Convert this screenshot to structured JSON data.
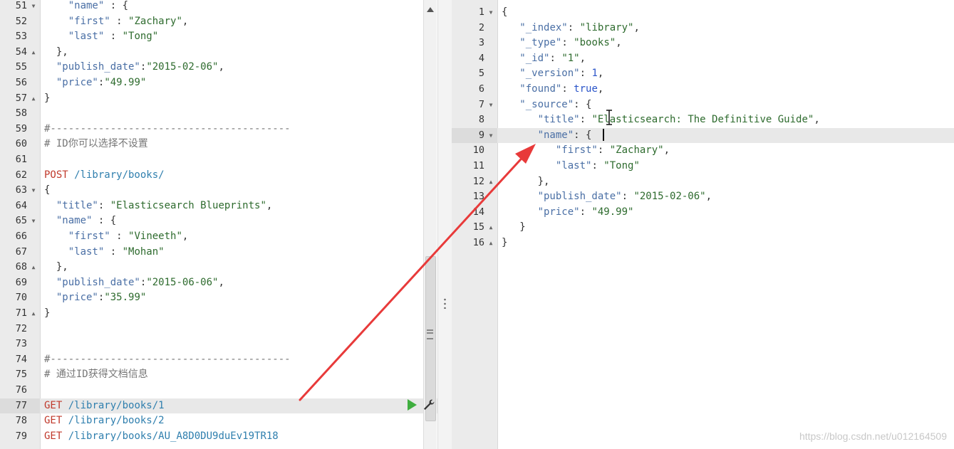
{
  "left_editor": {
    "lines": [
      {
        "n": "51",
        "fold": "down",
        "tokens": [
          [
            "    ",
            ""
          ],
          [
            "\"name\"",
            "key"
          ],
          [
            " : {",
            "punct"
          ]
        ]
      },
      {
        "n": "52",
        "fold": "",
        "tokens": [
          [
            "    ",
            ""
          ],
          [
            "\"first\"",
            "key"
          ],
          [
            " : ",
            "punct"
          ],
          [
            "\"Zachary\"",
            "str"
          ],
          [
            ",",
            "punct"
          ]
        ]
      },
      {
        "n": "53",
        "fold": "",
        "tokens": [
          [
            "    ",
            ""
          ],
          [
            "\"last\"",
            "key"
          ],
          [
            " : ",
            "punct"
          ],
          [
            "\"Tong\"",
            "str"
          ]
        ]
      },
      {
        "n": "54",
        "fold": "up",
        "tokens": [
          [
            "  },",
            "punct"
          ]
        ]
      },
      {
        "n": "55",
        "fold": "",
        "tokens": [
          [
            "  ",
            ""
          ],
          [
            "\"publish_date\"",
            "key"
          ],
          [
            ":",
            "punct"
          ],
          [
            "\"2015-02-06\"",
            "str"
          ],
          [
            ",",
            "punct"
          ]
        ]
      },
      {
        "n": "56",
        "fold": "",
        "tokens": [
          [
            "  ",
            ""
          ],
          [
            "\"price\"",
            "key"
          ],
          [
            ":",
            "punct"
          ],
          [
            "\"49.99\"",
            "str"
          ]
        ]
      },
      {
        "n": "57",
        "fold": "up",
        "tokens": [
          [
            "}",
            "punct"
          ]
        ]
      },
      {
        "n": "58",
        "fold": "",
        "tokens": []
      },
      {
        "n": "59",
        "fold": "",
        "tokens": [
          [
            "#----------------------------------------",
            "cmt"
          ]
        ]
      },
      {
        "n": "60",
        "fold": "",
        "tokens": [
          [
            "# ID你可以选择不设置",
            "cmt"
          ]
        ]
      },
      {
        "n": "61",
        "fold": "",
        "tokens": []
      },
      {
        "n": "62",
        "fold": "",
        "tokens": [
          [
            "POST",
            "method"
          ],
          [
            " /library/books/",
            "url"
          ]
        ]
      },
      {
        "n": "63",
        "fold": "down",
        "tokens": [
          [
            "{",
            "punct"
          ]
        ]
      },
      {
        "n": "64",
        "fold": "",
        "tokens": [
          [
            "  ",
            ""
          ],
          [
            "\"title\"",
            "key"
          ],
          [
            ": ",
            "punct"
          ],
          [
            "\"Elasticsearch Blueprints\"",
            "str"
          ],
          [
            ",",
            "punct"
          ]
        ]
      },
      {
        "n": "65",
        "fold": "down",
        "tokens": [
          [
            "  ",
            ""
          ],
          [
            "\"name\"",
            "key"
          ],
          [
            " : {",
            "punct"
          ]
        ]
      },
      {
        "n": "66",
        "fold": "",
        "tokens": [
          [
            "    ",
            ""
          ],
          [
            "\"first\"",
            "key"
          ],
          [
            " : ",
            "punct"
          ],
          [
            "\"Vineeth\"",
            "str"
          ],
          [
            ",",
            "punct"
          ]
        ]
      },
      {
        "n": "67",
        "fold": "",
        "tokens": [
          [
            "    ",
            ""
          ],
          [
            "\"last\"",
            "key"
          ],
          [
            " : ",
            "punct"
          ],
          [
            "\"Mohan\"",
            "str"
          ]
        ]
      },
      {
        "n": "68",
        "fold": "up",
        "tokens": [
          [
            "  },",
            "punct"
          ]
        ]
      },
      {
        "n": "69",
        "fold": "",
        "tokens": [
          [
            "  ",
            ""
          ],
          [
            "\"publish_date\"",
            "key"
          ],
          [
            ":",
            "punct"
          ],
          [
            "\"2015-06-06\"",
            "str"
          ],
          [
            ",",
            "punct"
          ]
        ]
      },
      {
        "n": "70",
        "fold": "",
        "tokens": [
          [
            "  ",
            ""
          ],
          [
            "\"price\"",
            "key"
          ],
          [
            ":",
            "punct"
          ],
          [
            "\"35.99\"",
            "str"
          ]
        ]
      },
      {
        "n": "71",
        "fold": "up",
        "tokens": [
          [
            "}",
            "punct"
          ]
        ]
      },
      {
        "n": "72",
        "fold": "",
        "tokens": []
      },
      {
        "n": "73",
        "fold": "",
        "tokens": []
      },
      {
        "n": "74",
        "fold": "",
        "tokens": [
          [
            "#----------------------------------------",
            "cmt"
          ]
        ]
      },
      {
        "n": "75",
        "fold": "",
        "tokens": [
          [
            "# 通过ID获得文档信息",
            "cmt"
          ]
        ]
      },
      {
        "n": "76",
        "fold": "",
        "tokens": []
      },
      {
        "n": "77",
        "fold": "",
        "active": true,
        "tokens": [
          [
            "GET",
            "method"
          ],
          [
            " /library/books/1",
            "url"
          ]
        ]
      },
      {
        "n": "78",
        "fold": "",
        "tokens": [
          [
            "GET",
            "method"
          ],
          [
            " /library/books/2",
            "url"
          ]
        ]
      },
      {
        "n": "79",
        "fold": "",
        "tokens": [
          [
            "GET",
            "method"
          ],
          [
            " /library/books/AU_A8D0DU9duEv19TR18",
            "url"
          ]
        ]
      }
    ]
  },
  "right_editor": {
    "lines": [
      {
        "n": "1",
        "fold": "down",
        "tokens": [
          [
            "{",
            "punct"
          ]
        ]
      },
      {
        "n": "2",
        "fold": "",
        "tokens": [
          [
            "   ",
            ""
          ],
          [
            "\"_index\"",
            "key"
          ],
          [
            ": ",
            "punct"
          ],
          [
            "\"library\"",
            "str"
          ],
          [
            ",",
            "punct"
          ]
        ]
      },
      {
        "n": "3",
        "fold": "",
        "tokens": [
          [
            "   ",
            ""
          ],
          [
            "\"_type\"",
            "key"
          ],
          [
            ": ",
            "punct"
          ],
          [
            "\"books\"",
            "str"
          ],
          [
            ",",
            "punct"
          ]
        ]
      },
      {
        "n": "4",
        "fold": "",
        "tokens": [
          [
            "   ",
            ""
          ],
          [
            "\"_id\"",
            "key"
          ],
          [
            ": ",
            "punct"
          ],
          [
            "\"1\"",
            "str"
          ],
          [
            ",",
            "punct"
          ]
        ]
      },
      {
        "n": "5",
        "fold": "",
        "tokens": [
          [
            "   ",
            ""
          ],
          [
            "\"_version\"",
            "key"
          ],
          [
            ": ",
            "punct"
          ],
          [
            "1",
            "num"
          ],
          [
            ",",
            "punct"
          ]
        ]
      },
      {
        "n": "6",
        "fold": "",
        "tokens": [
          [
            "   ",
            ""
          ],
          [
            "\"found\"",
            "key"
          ],
          [
            ": ",
            "punct"
          ],
          [
            "true",
            "bool"
          ],
          [
            ",",
            "punct"
          ]
        ]
      },
      {
        "n": "7",
        "fold": "down",
        "tokens": [
          [
            "   ",
            ""
          ],
          [
            "\"_source\"",
            "key"
          ],
          [
            ": {",
            "punct"
          ]
        ]
      },
      {
        "n": "8",
        "fold": "",
        "tokens": [
          [
            "      ",
            ""
          ],
          [
            "\"title\"",
            "key"
          ],
          [
            ": ",
            "punct"
          ],
          [
            "\"Elasticsearch: The Definitive Guide\"",
            "str"
          ],
          [
            ",",
            "punct"
          ]
        ]
      },
      {
        "n": "9",
        "fold": "down",
        "active": true,
        "tokens": [
          [
            "      ",
            ""
          ],
          [
            "\"name\"",
            "key"
          ],
          [
            ": {",
            "punct"
          ]
        ]
      },
      {
        "n": "10",
        "fold": "",
        "tokens": [
          [
            "         ",
            ""
          ],
          [
            "\"first\"",
            "key"
          ],
          [
            ": ",
            "punct"
          ],
          [
            "\"Zachary\"",
            "str"
          ],
          [
            ",",
            "punct"
          ]
        ]
      },
      {
        "n": "11",
        "fold": "",
        "tokens": [
          [
            "         ",
            ""
          ],
          [
            "\"last\"",
            "key"
          ],
          [
            ": ",
            "punct"
          ],
          [
            "\"Tong\"",
            "str"
          ]
        ]
      },
      {
        "n": "12",
        "fold": "up",
        "tokens": [
          [
            "      },",
            "punct"
          ]
        ]
      },
      {
        "n": "13",
        "fold": "",
        "tokens": [
          [
            "      ",
            ""
          ],
          [
            "\"publish_date\"",
            "key"
          ],
          [
            ": ",
            "punct"
          ],
          [
            "\"2015-02-06\"",
            "str"
          ],
          [
            ",",
            "punct"
          ]
        ]
      },
      {
        "n": "14",
        "fold": "",
        "tokens": [
          [
            "      ",
            ""
          ],
          [
            "\"price\"",
            "key"
          ],
          [
            ": ",
            "punct"
          ],
          [
            "\"49.99\"",
            "str"
          ]
        ]
      },
      {
        "n": "15",
        "fold": "up",
        "tokens": [
          [
            "   }",
            "punct"
          ]
        ]
      },
      {
        "n": "16",
        "fold": "up",
        "tokens": [
          [
            "}",
            "punct"
          ]
        ]
      }
    ]
  },
  "watermark": "https://blog.csdn.net/u012164509",
  "colors": {
    "arrow": "#e83a3a",
    "run_button": "#3fae3f"
  }
}
